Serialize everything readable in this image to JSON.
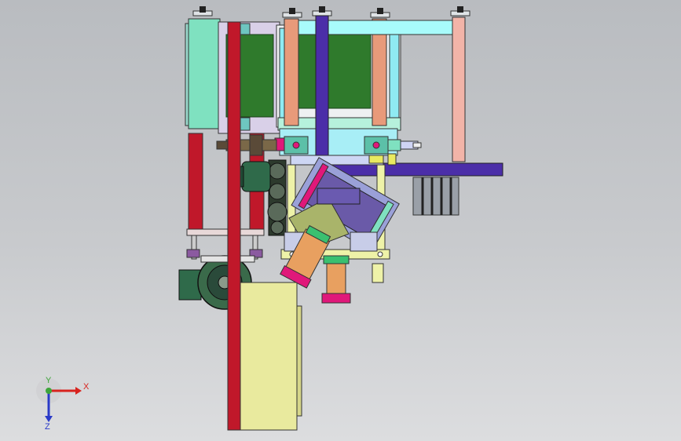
{
  "viewport": {
    "colors": {
      "background_top": "#b9bcc0",
      "background_bottom": "#dcdddf",
      "frame_green": "#2f7a2c",
      "cover_mint": "#7fe1c0",
      "column_red": "#c0182a",
      "beam_purple": "#4b2ea8",
      "cyan_beam": "#a8fbfb",
      "salmon": "#e89a7a",
      "pink_post": "#f2b4a8",
      "khaki_box": "#e9ea9e",
      "motor_green": "#2f6a4a",
      "magenta": "#e0187a"
    }
  },
  "triad": {
    "x_label": "X",
    "y_label": "Y",
    "z_label": "Z",
    "x_color": "#d8231e",
    "y_color": "#3ea53a",
    "z_color": "#2a3ac8"
  }
}
